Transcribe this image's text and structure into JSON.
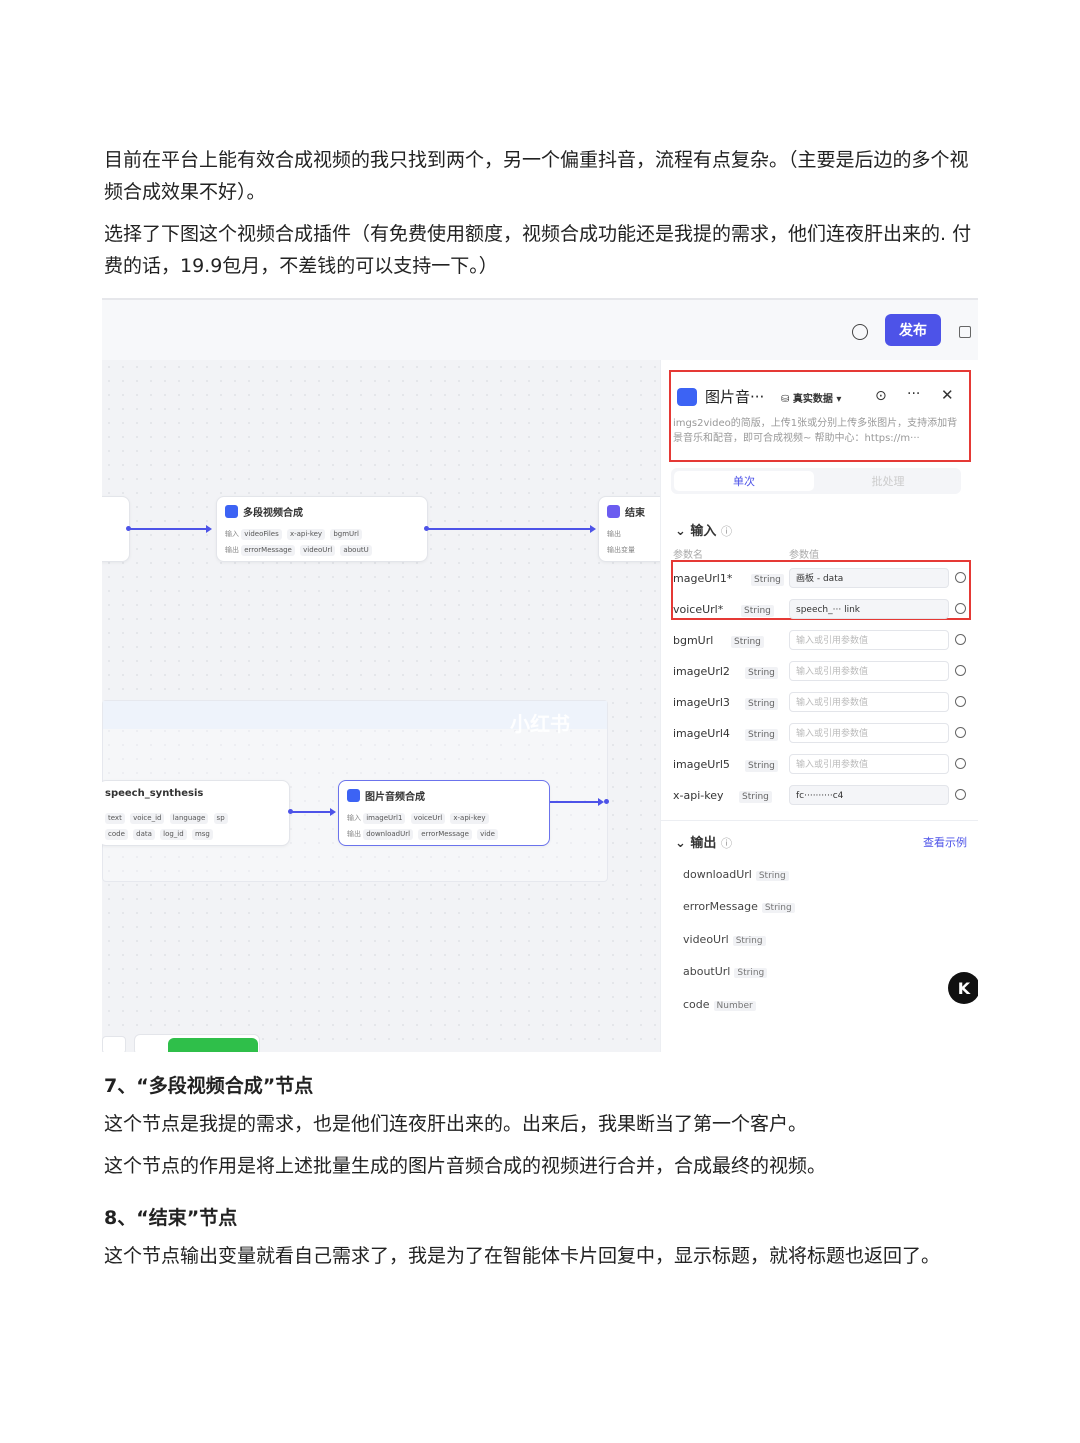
{
  "article": {
    "intro_1": "目前在平台上能有效合成视频的我只找到两个，另一个偏重抖音，流程有点复杂。（主要是后边的多个视频合成效果不好）。",
    "intro_2": "选择了下图这个视频合成插件（有免费使用额度，视频合成功能还是我提的需求，他们连夜肝出来的. 付费的话，19.9包月，不差钱的可以支持一下。）",
    "section7_title": "7、“多段视频合成”节点",
    "section7_p1": "这个节点是我提的需求，也是他们连夜肝出来的。出来后，我果断当了第一个客户。",
    "section7_p2": "这个节点的作用是将上述批量生成的图片音频合成的视频进行合并，合成最终的视频。",
    "section8_title": "8、“结束”节点",
    "section8_p1": "这个节点输出变量就看自己需求了，我是为了在智能体卡片回复中，显示标题，就将标题也返回了。"
  },
  "screenshot": {
    "publish_label": "发布",
    "watermark": "小红书",
    "nodes": {
      "multi_video": {
        "title": "多段视频合成",
        "input_label": "输入",
        "inputs": [
          "videoFiles",
          "x-api-key",
          "bgmUrl"
        ],
        "output_label": "输出",
        "outputs": [
          "errorMessage",
          "videoUrl",
          "aboutU"
        ]
      },
      "end": {
        "title": "结束",
        "row1": "输出",
        "row2": "输出变量"
      },
      "speech": {
        "title": "speech_synthesis",
        "row1": [
          "text",
          "voice_id",
          "language",
          "sp"
        ],
        "row2": [
          "code",
          "data",
          "log_id",
          "msg"
        ]
      },
      "img_audio": {
        "title": "图片音频合成",
        "input_label": "输入",
        "inputs": [
          "imageUrl1",
          "voiceUrl",
          "x-api-key"
        ],
        "output_label": "输出",
        "outputs": [
          "downloadUrl",
          "errorMessage",
          "vide"
        ]
      }
    },
    "panel": {
      "title": "图片音···",
      "mode": "真实数据",
      "description": "imgs2video的简版，上传1张或分别上传多张图片，支持添加背景音乐和配音，即可合成视频~ 帮助中心：https://m···",
      "tab_single": "单次",
      "tab_batch": "批处理",
      "input_section": "输入",
      "col_name": "参数名",
      "col_value": "参数值",
      "params": [
        {
          "name": "mageUrl1*",
          "type": "String",
          "value": "画板 - data",
          "filled": true
        },
        {
          "name": "voiceUrl*",
          "type": "String",
          "value": "speech_··· link",
          "filled": true
        },
        {
          "name": "bgmUrl",
          "type": "String",
          "value": "输入或引用参数值",
          "filled": false
        },
        {
          "name": "imageUrl2",
          "type": "String",
          "value": "输入或引用参数值",
          "filled": false
        },
        {
          "name": "imageUrl3",
          "type": "String",
          "value": "输入或引用参数值",
          "filled": false
        },
        {
          "name": "imageUrl4",
          "type": "String",
          "value": "输入或引用参数值",
          "filled": false
        },
        {
          "name": "imageUrl5",
          "type": "String",
          "value": "输入或引用参数值",
          "filled": false
        },
        {
          "name": "x-api-key",
          "type": "String",
          "value": "fc··········c4",
          "filled": true
        }
      ],
      "output_section": "输出",
      "view_example": "查看示例",
      "outputs": [
        {
          "name": "downloadUrl",
          "type": "String"
        },
        {
          "name": "errorMessage",
          "type": "String"
        },
        {
          "name": "videoUrl",
          "type": "String"
        },
        {
          "name": "aboutUrl",
          "type": "String"
        },
        {
          "name": "code",
          "type": "Number"
        }
      ]
    }
  }
}
